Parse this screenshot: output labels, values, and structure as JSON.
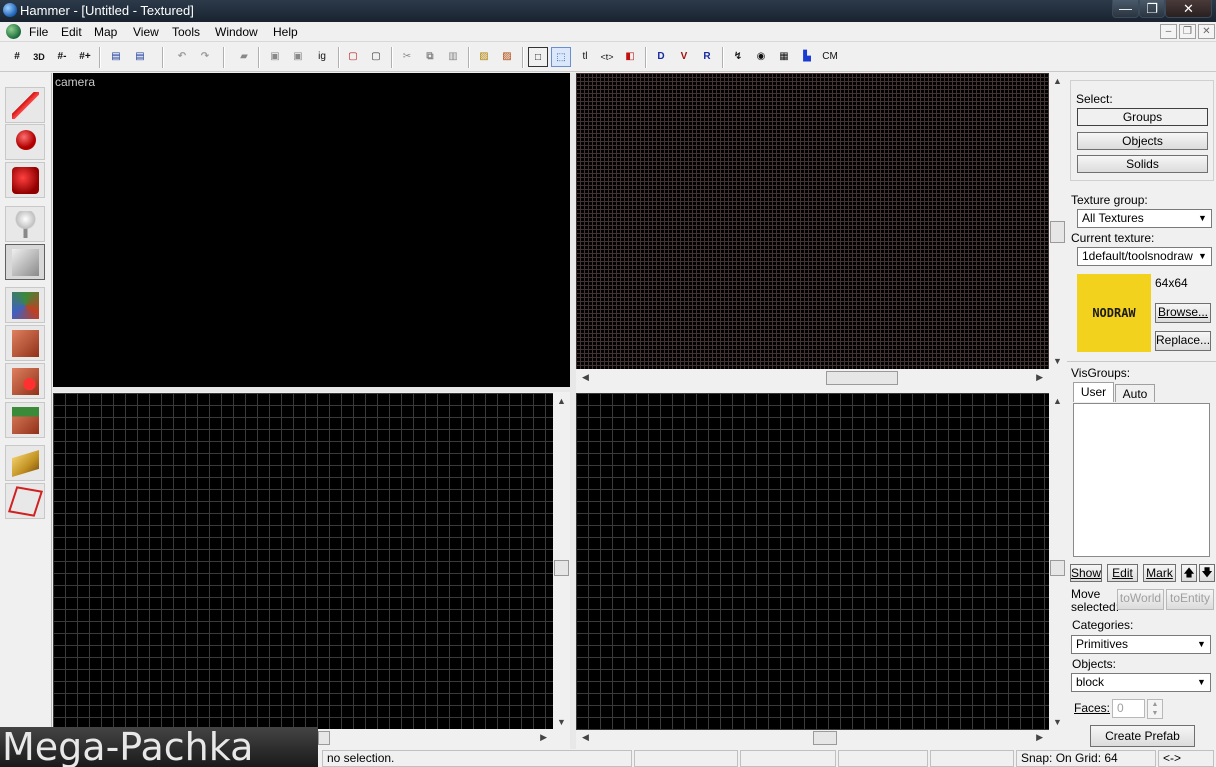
{
  "window": {
    "title": "Hammer - [Untitled - Textured]",
    "minimize": "—",
    "maximize": "❐",
    "close": "✕"
  },
  "menu": [
    "File",
    "Edit",
    "Map",
    "View",
    "Tools",
    "Window",
    "Help"
  ],
  "mdi": {
    "minimize": "–",
    "restore": "❐",
    "close": "✕"
  },
  "toolbar": {
    "ignore_label": "ig",
    "tl_label": "tl",
    "cm_label": "CM"
  },
  "viewports": {
    "camera_label": "camera"
  },
  "right_panel": {
    "select_label": "Select:",
    "groups": "Groups",
    "objects": "Objects",
    "solids": "Solids",
    "texture_group_label": "Texture group:",
    "texture_group_value": "All Textures",
    "current_texture_label": "Current texture:",
    "current_texture_value": "1default/toolsnodraw",
    "texture_preview_text": "NODRAW",
    "texture_size": "64x64",
    "browse": "Browse...",
    "replace": "Replace...",
    "visgroups_label": "VisGroups:",
    "tab_user": "User",
    "tab_auto": "Auto",
    "show": "Show",
    "edit": "Edit",
    "mark": "Mark",
    "up_icon": "🡅",
    "down_icon": "🡇",
    "move_selected_1": "Move",
    "move_selected_2": "selected:",
    "to_world": "toWorld",
    "to_entity": "toEntity",
    "categories_label": "Categories:",
    "categories_value": "Primitives",
    "objects_label": "Objects:",
    "objects_value": "block",
    "faces_label": "Faces:",
    "faces_value": "0",
    "create_prefab": "Create Prefab"
  },
  "status": {
    "selection": "no selection.",
    "snap": "Snap: On Grid: 64",
    "mode": "<->"
  },
  "watermark": "Mega-Pachka",
  "colors": {
    "texture_yellow": "#f3d21e",
    "title_bar": "#1f2b38"
  }
}
